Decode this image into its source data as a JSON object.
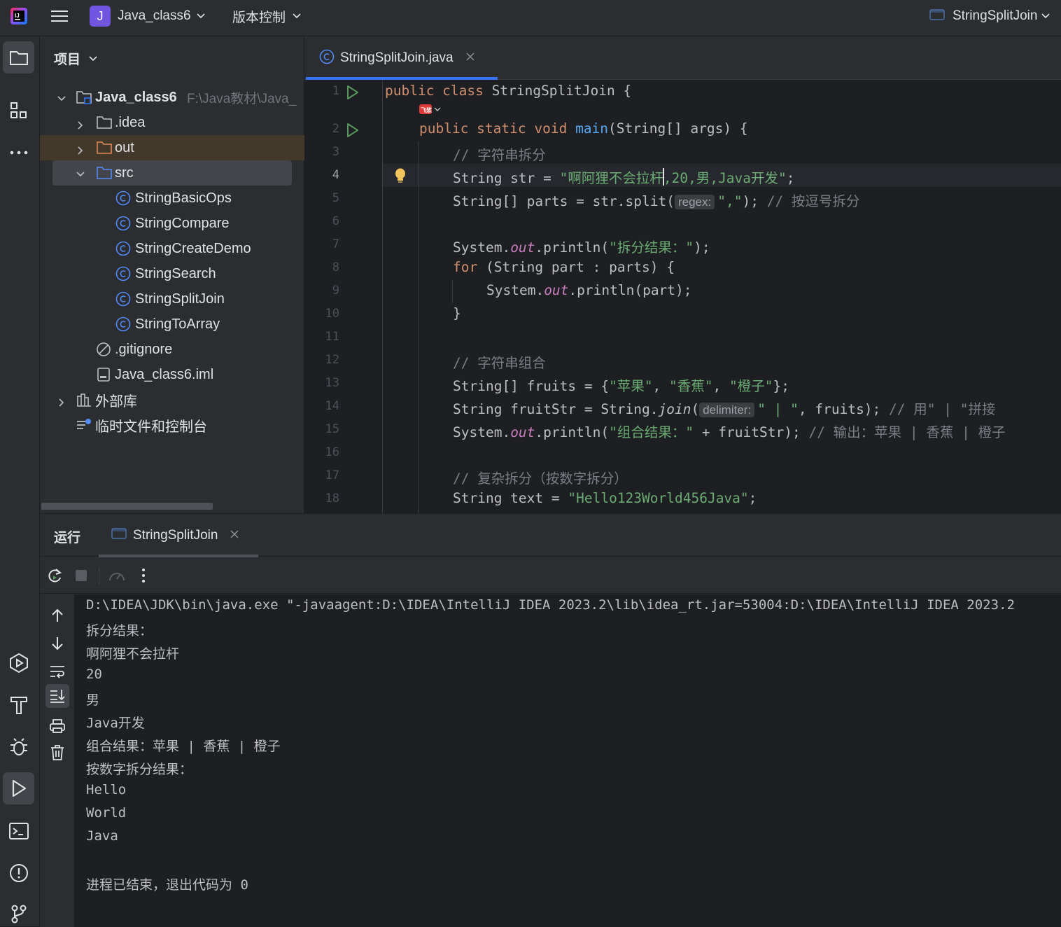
{
  "titlebar": {
    "project_badge": "J",
    "project_name": "Java_class6",
    "vcs_label": "版本控制",
    "run_config": "StringSplitJoin"
  },
  "project_panel": {
    "title": "项目",
    "root_name": "Java_class6",
    "root_path": "F:\\Java教材\\Java_",
    "items": [
      {
        "label": ".idea"
      },
      {
        "label": "out"
      },
      {
        "label": "src"
      },
      {
        "label": "StringBasicOps"
      },
      {
        "label": "StringCompare"
      },
      {
        "label": "StringCreateDemo"
      },
      {
        "label": "StringSearch"
      },
      {
        "label": "StringSplitJoin"
      },
      {
        "label": "StringToArray"
      },
      {
        "label": ".gitignore"
      },
      {
        "label": "Java_class6.iml"
      },
      {
        "label": "外部库"
      },
      {
        "label": "临时文件和控制台"
      }
    ]
  },
  "editor": {
    "tab_label": "StringSplitJoin.java",
    "line_numbers": [
      "1",
      "2",
      "3",
      "4",
      "5",
      "6",
      "7",
      "8",
      "9",
      "10",
      "11",
      "12",
      "13",
      "14",
      "15",
      "16",
      "17",
      "18"
    ],
    "code": {
      "l1_kw": "public class ",
      "l1_rest": "StringSplitJoin {",
      "l2_kw": "public static void ",
      "l2_fn": "main",
      "l2_rest": "(String[] args) {",
      "l3": "// 字符串拆分",
      "l4_a": "String str = ",
      "l4_s": "\"啊阿狸不会拉杆,20,男,Java开发\"",
      "l4_b": ";",
      "l5_a": "String[] parts = str.split(",
      "l5_hint": "regex:",
      "l5_s": "\",\"",
      "l5_b": "); ",
      "l5_c": "// 按逗号拆分",
      "l7_a": "System.",
      "l7_o": "out",
      "l7_b": ".println(",
      "l7_s": "\"拆分结果：\"",
      "l7_c": ");",
      "l8_kw": "for",
      "l8_rest": " (String part : parts) {",
      "l9_a": "System.",
      "l9_o": "out",
      "l9_b": ".println(part);",
      "l10": "}",
      "l12": "// 字符串组合",
      "l13_a": "String[] fruits = {",
      "l13_s1": "\"苹果\"",
      "l13_s2": "\"香蕉\"",
      "l13_s3": "\"橙子\"",
      "l13_b": "};",
      "l14_a": "String fruitStr = String.",
      "l14_fn": "join",
      "l14_hint": "delimiter:",
      "l14_s": "\" | \"",
      "l14_b": ", fruits); ",
      "l14_c": "// 用\" | \"拼接",
      "l15_a": "System.",
      "l15_o": "out",
      "l15_b": ".println(",
      "l15_s": "\"组合结果：\"",
      "l15_c": " + fruitStr); ",
      "l15_cm": "// 输出：苹果 | 香蕉 | 橙子",
      "l17": "// 复杂拆分（按数字拆分）",
      "l18_a": "String text = ",
      "l18_s": "\"Hello123World456Java\"",
      "l18_b": ";"
    }
  },
  "run_panel": {
    "title": "运行",
    "tab_label": "StringSplitJoin",
    "output": [
      "D:\\IDEA\\JDK\\bin\\java.exe \"-javaagent:D:\\IDEA\\IntelliJ IDEA 2023.2\\lib\\idea_rt.jar=53004:D:\\IDEA\\IntelliJ IDEA 2023.2",
      "拆分结果：",
      "啊阿狸不会拉杆",
      "20",
      "男",
      "Java开发",
      "组合结果：苹果 | 香蕉 | 橙子",
      "按数字拆分结果：",
      "Hello",
      "World",
      "Java",
      "",
      "进程已结束，退出代码为 0"
    ]
  },
  "colors": {
    "accent": "#3574f0",
    "keyword": "#cf8e6d",
    "string": "#6aab73",
    "comment": "#7a7e85",
    "function": "#56a8f5",
    "static_field": "#c77dbb",
    "run_green": "#57965c"
  },
  "icons": [
    "app-logo-icon",
    "hamburger-menu-icon",
    "chevron-down-icon",
    "window-icon",
    "folder-icon",
    "structure-icon",
    "more-icon",
    "class-icon",
    "close-icon",
    "run-gutter-icon",
    "lightbulb-icon",
    "rerun-icon",
    "stop-icon",
    "speedometer-icon",
    "up-arrow-icon",
    "down-arrow-icon",
    "soft-wrap-icon",
    "scroll-end-icon",
    "print-icon",
    "trash-icon",
    "services-icon",
    "build-icon",
    "debug-icon",
    "run-icon",
    "terminal-icon",
    "problems-icon",
    "git-icon"
  ]
}
